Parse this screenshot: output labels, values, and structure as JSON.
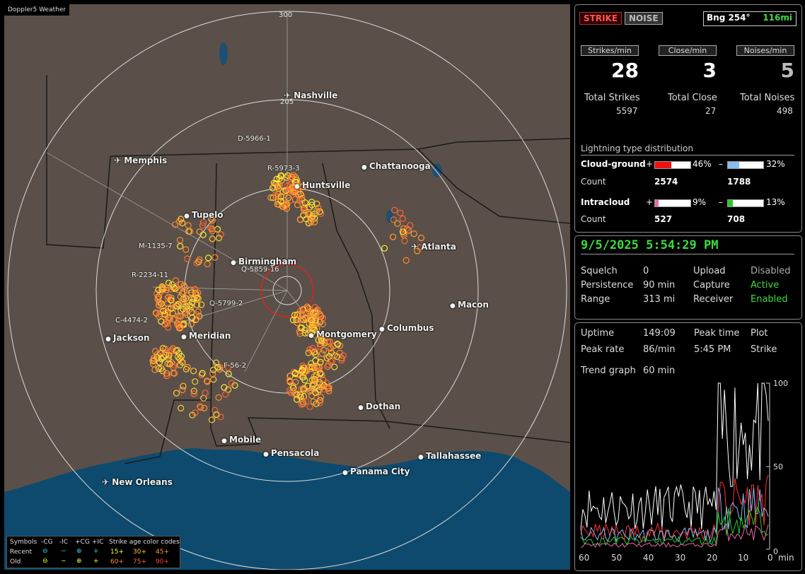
{
  "app": {
    "title": "Doppler5 Weather"
  },
  "map": {
    "ring_labels": [
      "300",
      "205"
    ],
    "cities": [
      {
        "name": "Nashville",
        "icon": "airport"
      },
      {
        "name": "Memphis",
        "icon": "airport"
      },
      {
        "name": "Chattanooga",
        "icon": "dot"
      },
      {
        "name": "Huntsville",
        "icon": "dot"
      },
      {
        "name": "Tupelo",
        "icon": "dot"
      },
      {
        "name": "Atlanta",
        "icon": "airport"
      },
      {
        "name": "Birmingham",
        "icon": "dot"
      },
      {
        "name": "Macon",
        "icon": "dot"
      },
      {
        "name": "Jackson",
        "icon": "dot"
      },
      {
        "name": "Meridian",
        "icon": "dot"
      },
      {
        "name": "Montgomery",
        "icon": "dot"
      },
      {
        "name": "Columbus",
        "icon": "dot"
      },
      {
        "name": "Dothan",
        "icon": "dot"
      },
      {
        "name": "Mobile",
        "icon": "dot"
      },
      {
        "name": "Pensacola",
        "icon": "dot"
      },
      {
        "name": "Tallahassee",
        "icon": "dot"
      },
      {
        "name": "Panama City",
        "icon": "dot"
      },
      {
        "name": "New Orleans",
        "icon": "airport"
      }
    ],
    "storm_labels": [
      "D-5966-1",
      "R-5973-3",
      "M-1135-7",
      "R-2234-11",
      "C-4474-2",
      "Q-5799-2",
      "Q-5859-16",
      "F-56-2"
    ]
  },
  "legend": {
    "symbols_title": "Symbols",
    "columns": [
      "-CG",
      "-IC",
      "+CG",
      "+IC"
    ],
    "rows": [
      "Recent",
      "Old"
    ],
    "age_title": "Strike age color codes",
    "ages_recent": [
      "15+",
      "30+",
      "45+"
    ],
    "ages_old": [
      "60+",
      "75+",
      "90+"
    ],
    "age_colors_recent": [
      "#ffff33",
      "#ffcc33",
      "#ff9933"
    ],
    "age_colors_old": [
      "#ff8833",
      "#ff6633",
      "#ff4433"
    ]
  },
  "panel_stats": {
    "strike_btn": "STRIKE",
    "noise_btn": "NOISE",
    "bearing": "Bng 254°",
    "distance": "116mi",
    "rate_headers": [
      "Strikes/min",
      "Close/min",
      "Noises/min"
    ],
    "rates": [
      "28",
      "3",
      "5"
    ],
    "total_labels": [
      "Total Strikes",
      "Total Close",
      "Total Noises"
    ],
    "totals": [
      "5597",
      "27",
      "498"
    ],
    "dist_title": "Lightning type distribution",
    "cg_label": "Cloud-ground",
    "ic_label": "Intracloud",
    "count_label": "Count",
    "plus": "+",
    "minus": "–",
    "cg_pos_pct": "46%",
    "cg_neg_pct": "32%",
    "ic_pos_pct": "9%",
    "ic_neg_pct": "13%",
    "cg_pos_frac": 0.46,
    "cg_neg_frac": 0.32,
    "ic_pos_frac": 0.09,
    "ic_neg_frac": 0.13,
    "cg_pos_count": "2574",
    "cg_neg_count": "1788",
    "ic_pos_count": "527",
    "ic_neg_count": "708"
  },
  "panel_status": {
    "datetime": "9/5/2025 5:54:29 PM",
    "squelch_label": "Squelch",
    "squelch": "0",
    "persistence_label": "Persistence",
    "persistence": "90 min",
    "range_label": "Range",
    "range": "313 mi",
    "upload_label": "Upload",
    "upload": "Disabled",
    "capture_label": "Capture",
    "capture": "Active",
    "receiver_label": "Receiver",
    "receiver": "Enabled"
  },
  "panel_trend": {
    "uptime_label": "Uptime",
    "uptime": "149:09",
    "peak_time_label": "Peak time",
    "peak_time": "5:45 PM",
    "plot_label": "Plot",
    "plot": "Strike",
    "peak_rate_label": "Peak rate",
    "peak_rate": "86/min",
    "trend_label": "Trend graph",
    "trend": "60 min",
    "y_ticks": [
      "100",
      "50",
      "0"
    ],
    "x_ticks": [
      "60",
      "50",
      "40",
      "30",
      "20",
      "10",
      "0"
    ],
    "x_unit": "min"
  }
}
